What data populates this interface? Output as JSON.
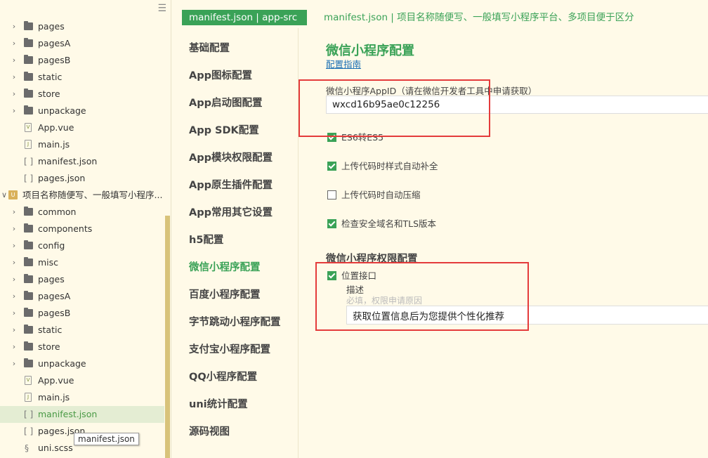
{
  "sidebar": {
    "items": [
      {
        "type": "folder",
        "label": "pages",
        "indent": 0
      },
      {
        "type": "folder",
        "label": "pagesA",
        "indent": 0
      },
      {
        "type": "folder",
        "label": "pagesB",
        "indent": 0
      },
      {
        "type": "folder",
        "label": "static",
        "indent": 0
      },
      {
        "type": "folder",
        "label": "store",
        "indent": 0
      },
      {
        "type": "folder",
        "label": "unpackage",
        "indent": 0
      },
      {
        "type": "vue",
        "label": "App.vue",
        "indent": 0
      },
      {
        "type": "js",
        "label": "main.js",
        "indent": 0
      },
      {
        "type": "json",
        "label": "manifest.json",
        "indent": 0
      },
      {
        "type": "json",
        "label": "pages.json",
        "indent": 0
      },
      {
        "type": "project",
        "label": "项目名称随便写、一般填写小程序...",
        "indent": -1
      },
      {
        "type": "folder",
        "label": "common",
        "indent": 0
      },
      {
        "type": "folder",
        "label": "components",
        "indent": 0
      },
      {
        "type": "folder",
        "label": "config",
        "indent": 0
      },
      {
        "type": "folder",
        "label": "misc",
        "indent": 0
      },
      {
        "type": "folder",
        "label": "pages",
        "indent": 0
      },
      {
        "type": "folder",
        "label": "pagesA",
        "indent": 0
      },
      {
        "type": "folder",
        "label": "pagesB",
        "indent": 0
      },
      {
        "type": "folder",
        "label": "static",
        "indent": 0
      },
      {
        "type": "folder",
        "label": "store",
        "indent": 0
      },
      {
        "type": "folder",
        "label": "unpackage",
        "indent": 0
      },
      {
        "type": "vue",
        "label": "App.vue",
        "indent": 0
      },
      {
        "type": "js",
        "label": "main.js",
        "indent": 0
      },
      {
        "type": "json",
        "label": "manifest.json",
        "indent": 0,
        "selected": true
      },
      {
        "type": "json",
        "label": "pages.json",
        "indent": 0
      },
      {
        "type": "scss",
        "label": "uni.scss",
        "indent": 0
      }
    ],
    "tooltip": "manifest.json"
  },
  "header": {
    "tab_label": "manifest.json | app-src",
    "description": "manifest.json | 项目名称随便写、一般填写小程序平台、多项目便于区分"
  },
  "nav": {
    "items": [
      "基础配置",
      "App图标配置",
      "App启动图配置",
      "App SDK配置",
      "App模块权限配置",
      "App原生插件配置",
      "App常用其它设置",
      "h5配置",
      "微信小程序配置",
      "百度小程序配置",
      "字节跳动小程序配置",
      "支付宝小程序配置",
      "QQ小程序配置",
      "uni统计配置",
      "源码视图"
    ],
    "active_index": 8
  },
  "main": {
    "title": "微信小程序配置",
    "guide_link": "配置指南",
    "appid_label": "微信小程序AppID（请在微信开发者工具中申请获取）",
    "appid_value": "wxcd16b95ae0c12256",
    "checkboxes": [
      {
        "label": "ES6转ES5",
        "checked": true
      },
      {
        "label": "上传代码时样式自动补全",
        "checked": true
      },
      {
        "label": "上传代码时自动压缩",
        "checked": false
      },
      {
        "label": "检查安全域名和TLS版本",
        "checked": true
      }
    ],
    "permission_title": "微信小程序权限配置",
    "location_label": "位置接口",
    "location_checked": true,
    "desc_label": "描述",
    "desc_hint": "必填，权限申请原因",
    "desc_value": "获取位置信息后为您提供个性化推荐"
  },
  "colors": {
    "accent": "#3aa257",
    "background": "#fffae8",
    "highlight_box": "#e43b3b"
  }
}
